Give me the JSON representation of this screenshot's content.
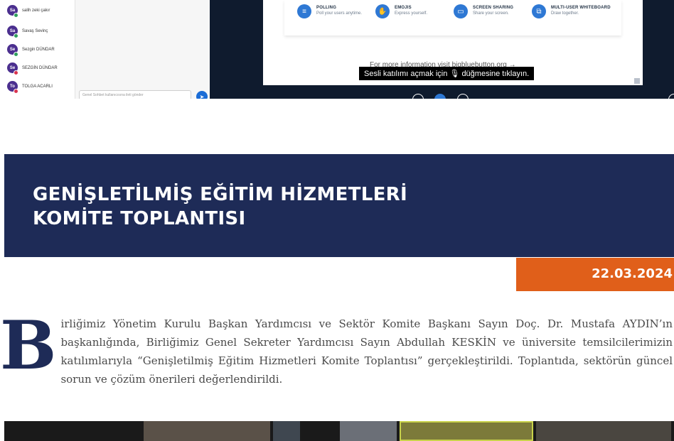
{
  "meeting_screenshot": {
    "participants": [
      {
        "initials": "Sa",
        "name": "salih zeki çakır",
        "status_color": "#2e9e5b"
      },
      {
        "initials": "Sa",
        "name": "Savaş Sevinç",
        "status_color": "#2e9e5b"
      },
      {
        "initials": "Se",
        "name": "Sezgin DÜNDAR",
        "status_color": "#2e9e5b"
      },
      {
        "initials": "Se",
        "name": "SEZGİN DÜNDAR",
        "status_color": "#d9334f"
      },
      {
        "initials": "To",
        "name": "TOLGA ACARLI",
        "status_color": "#d9334f"
      }
    ],
    "chat_placeholder": "Genel Sohbet kullanıcısına ileti gönder",
    "features": [
      {
        "icon": "poll-icon",
        "glyph": "≡",
        "title": "POLLING",
        "desc": "Poll your users anytime."
      },
      {
        "icon": "emoji-hand-icon",
        "glyph": "✋",
        "title": "EMOJIS",
        "desc": "Express yourself."
      },
      {
        "icon": "screen-share-icon",
        "glyph": "▭",
        "title": "SCREEN SHARING",
        "desc": "Share your screen."
      },
      {
        "icon": "whiteboard-icon",
        "glyph": "⧉",
        "title": "MULTI-USER WHITEBOARD",
        "desc": "Draw together."
      }
    ],
    "more_info": "For more information visit bigbluebutton.org →",
    "tooltip": "Sesli katılımı açmak için 🎙 düğmesine tıklayın."
  },
  "banner": {
    "title_line1": "GENİŞLETİLMİŞ EĞİTİM HİZMETLERİ",
    "title_line2": "KOMİTE TOPLANTISI"
  },
  "date": "22.03.2024",
  "article": {
    "drop_cap": "B",
    "body": "irliğimiz Yönetim Kurulu Başkan Yardımcısı ve Sektör Komite Başkanı Sayın Doç. Dr. Mustafa AYDIN’ın başkanlığında, Birliğimiz Genel Sekreter Yardımcısı Sayın Abdullah KESKİN ve üniversite temsilcilerimizin katılımlarıyla “Genişletilmiş Eğitim Hizmetleri Komite Toplantısı” gerçekleştirildi. Toplantıda, sektörün güncel sorun ve çözüm önerileri değerlendirildi."
  },
  "colors": {
    "banner_bg": "#1e2b57",
    "date_bg": "#e05f1a",
    "accent_blue": "#2e78d4"
  }
}
